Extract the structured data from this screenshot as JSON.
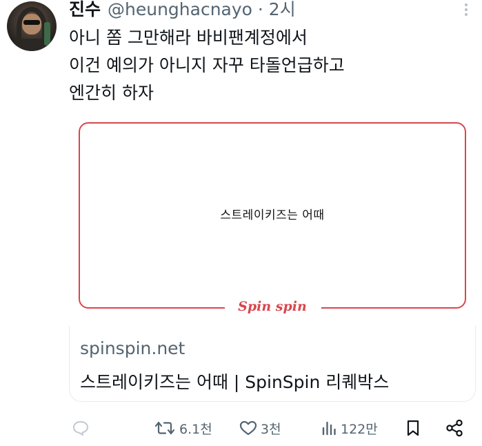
{
  "tweet": {
    "display_name": "진수",
    "handle_time": "@heunghacnayo · 2시",
    "text_lines": [
      "아니 쫌 그만해라 바비팬계정에서",
      "이건 예의가 아니지 자꾸 타돌언급하고",
      "엔간히 하자"
    ]
  },
  "card": {
    "image_text": "스트레이키즈는 어때",
    "logo_text": "Spin spin",
    "domain": "spinspin.net",
    "title": "스트레이키즈는 어때 | SpinSpin 리퀘박스"
  },
  "actions": {
    "reply_icon": "reply-icon",
    "retweet_icon": "retweet-icon",
    "retweet_count": "6.1천",
    "like_icon": "heart-icon",
    "like_count": "3천",
    "views_icon": "views-icon",
    "views_count": "122만",
    "bookmark_icon": "bookmark-icon",
    "share_icon": "share-icon"
  },
  "colors": {
    "accent_red": "#d9454d",
    "secondary_text": "#536471",
    "primary_text": "#0f1419"
  }
}
